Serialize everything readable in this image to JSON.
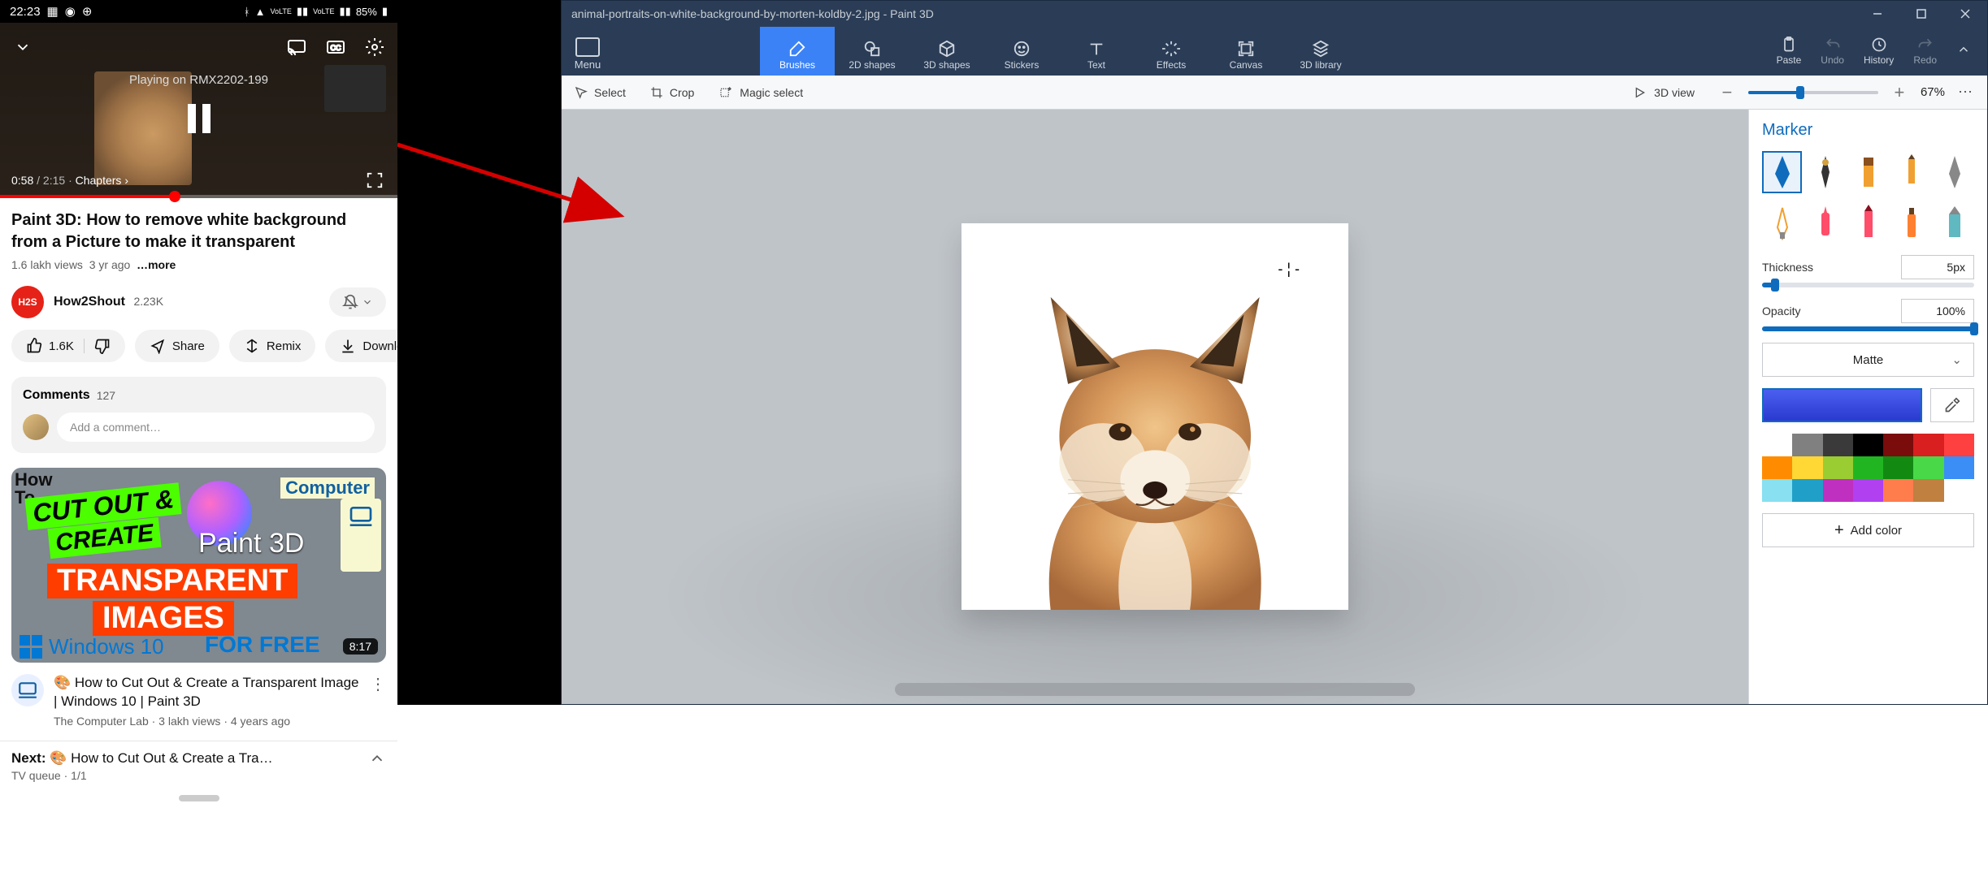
{
  "phone": {
    "status": {
      "time": "22:23",
      "battery": "85%",
      "icons": [
        "image",
        "whatsapp",
        "spinner"
      ],
      "right": [
        "bt",
        "wifi",
        "Vo LTE",
        "sig",
        "Vo LTE2",
        "sig2"
      ]
    },
    "player": {
      "casting_label": "Playing on RMX2202-199",
      "current_time": "0:58",
      "duration": "2:15",
      "chapters_label": "Chapters"
    },
    "video": {
      "title": "Paint 3D: How to remove white background from a Picture to make it transparent",
      "views": "1.6 lakh views",
      "age": "3 yr ago",
      "more": "…more"
    },
    "channel": {
      "avatar": "H2S",
      "name": "How2Shout",
      "subs": "2.23K"
    },
    "actions": {
      "likes": "1.6K",
      "share": "Share",
      "remix": "Remix",
      "download": "Downloa"
    },
    "comments": {
      "label": "Comments",
      "count": "127",
      "placeholder": "Add a comment…"
    },
    "reco": {
      "badge_how": "How\nTo",
      "cut_out": "CUT OUT &",
      "create": "CREATE",
      "computer": "Computer",
      "paint3d": "Paint 3D",
      "transparent": "TRANSPARENT",
      "images": "IMAGES",
      "win10": "Windows 10",
      "forfree": "FOR FREE",
      "duration": "8:17",
      "title": "🎨 How to Cut Out & Create a Transparent Image |  Windows 10 | Paint 3D",
      "sub": "The Computer Lab · 3 lakh views · 4 years ago"
    },
    "next": {
      "label": "Next:",
      "title": "🎨 How to Cut Out & Create a Tra…",
      "queue": "TV queue · 1/1"
    }
  },
  "paint3d": {
    "title": "animal-portraits-on-white-background-by-morten-koldby-2.jpg - Paint 3D",
    "menu": "Menu",
    "tabs": {
      "brushes": "Brushes",
      "shapes2d": "2D shapes",
      "shapes3d": "3D shapes",
      "stickers": "Stickers",
      "text": "Text",
      "effects": "Effects",
      "canvas": "Canvas",
      "library": "3D library"
    },
    "right_tools": {
      "paste": "Paste",
      "undo": "Undo",
      "history": "History",
      "redo": "Redo"
    },
    "subbar": {
      "select": "Select",
      "crop": "Crop",
      "magic": "Magic select",
      "view3d": "3D view",
      "zoom_pct": "67%"
    },
    "panel": {
      "title": "Marker",
      "thickness_label": "Thickness",
      "thickness_value": "5px",
      "opacity_label": "Opacity",
      "opacity_value": "100%",
      "material": "Matte",
      "add_color": "Add color",
      "palette": [
        "#ffffff",
        "#808080",
        "#000000",
        "#7a0c0c",
        "#d91f1f",
        "#ff4040",
        "#3a8ef6",
        "#ff8c00",
        "#ffd000",
        "#9acd32",
        "#2e8b2e",
        "#1aa01a",
        "#3a8ef6",
        "#66d9e8",
        "#1a90c0",
        "#c030c0",
        "#b040f0",
        "#ff7c4d",
        "#c08040",
        "#3a8ef6",
        "#66d9e8"
      ]
    }
  }
}
